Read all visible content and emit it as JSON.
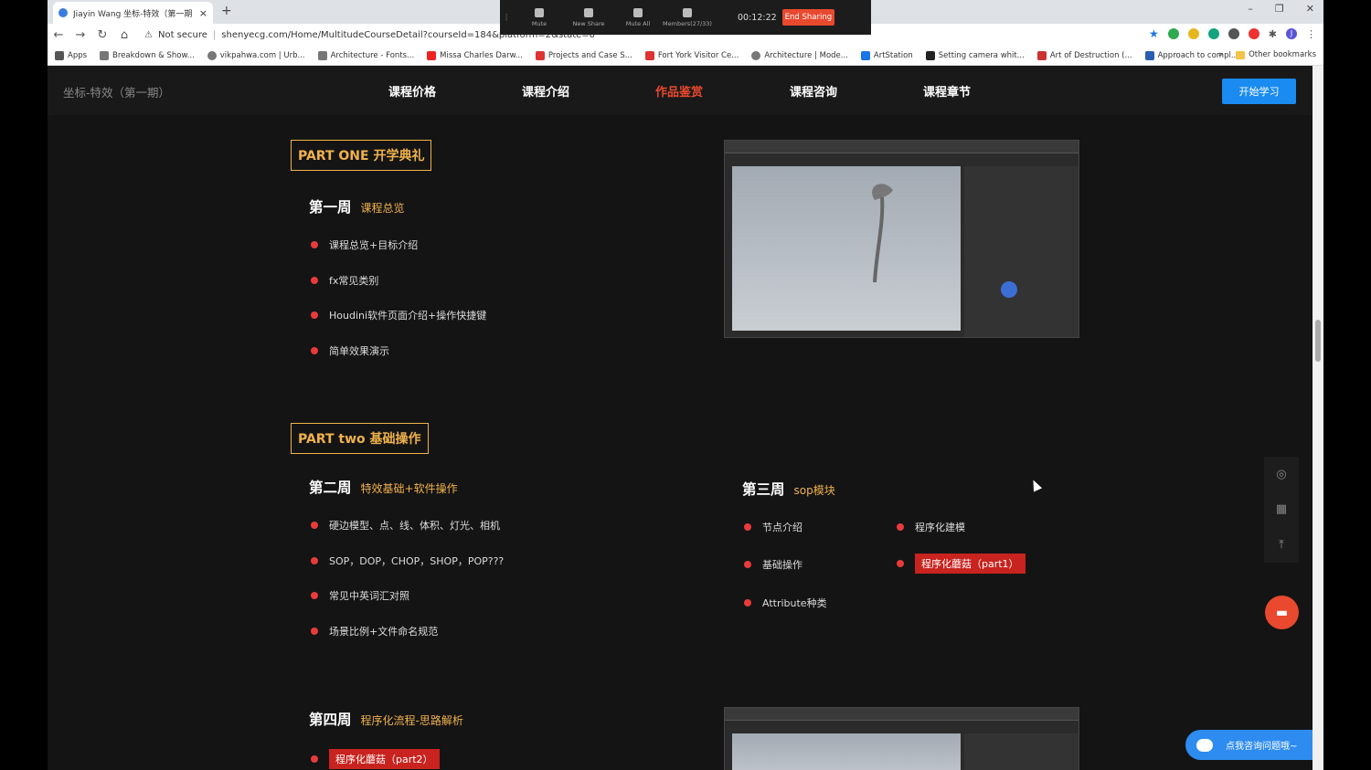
{
  "browser": {
    "tab_title": "Jiayin Wang 坐标-特效（第一期",
    "tab_close": "×",
    "new_tab": "+",
    "security": "Not secure",
    "url": "shenyecg.com/Home/MultitudeCourseDetail?courseId=184&platform=2&state=0",
    "window_controls": [
      "–",
      "❐",
      "✕"
    ],
    "bookmarks": [
      "Apps",
      "Breakdown & Show...",
      "vikpahwa.com | Urb...",
      "Architecture - Fonts...",
      "Missa Charles Darw...",
      "Projects and Case S...",
      "Fort York Visitor Ce...",
      "Architecture | Mode...",
      "ArtStation",
      "Setting camera whit...",
      "Art of Destruction (...",
      "Approach to compl..."
    ],
    "more_bookmarks": "»",
    "other_bookmarks": "Other bookmarks",
    "profile_initial": "J"
  },
  "zoom": {
    "mute": "Mute",
    "new_share": "New Share",
    "mute_all": "Mute All",
    "members": "Members(27/33)",
    "timer": "00:12:22",
    "end_sharing": "End Sharing"
  },
  "site": {
    "brand": "坐标-特效（第一期）",
    "nav": [
      "课程价格",
      "课程介绍",
      "作品鉴赏",
      "课程咨询",
      "课程章节"
    ],
    "start_button": "开始学习",
    "part_one": "PART ONE 开学典礼",
    "part_two": "PART two 基础操作",
    "week1": {
      "label": "第一周",
      "title": "课程总览",
      "items": [
        "课程总览+目标介绍",
        "fx常见类别",
        "Houdini软件页面介绍+操作快捷键",
        "简单效果演示"
      ]
    },
    "week2": {
      "label": "第二周",
      "title": "特效基础+软件操作",
      "items": [
        "硬边模型、点、线、体积、灯光、相机",
        "SOP，DOP，CHOP，SHOP，POP???",
        "常见中英词汇对照",
        "场景比例+文件命名规范"
      ]
    },
    "week3": {
      "label": "第三周",
      "title": "sop模块",
      "items_left": [
        "节点介绍",
        "基础操作",
        "Attribute种类"
      ],
      "items_right": [
        "程序化建模",
        "程序化蘑菇（part1）"
      ]
    },
    "week4": {
      "label": "第四周",
      "title": "程序化流程-思路解析",
      "items": [
        "程序化蘑菇（part2）"
      ]
    },
    "consult": "点我咨询问题哦~"
  }
}
